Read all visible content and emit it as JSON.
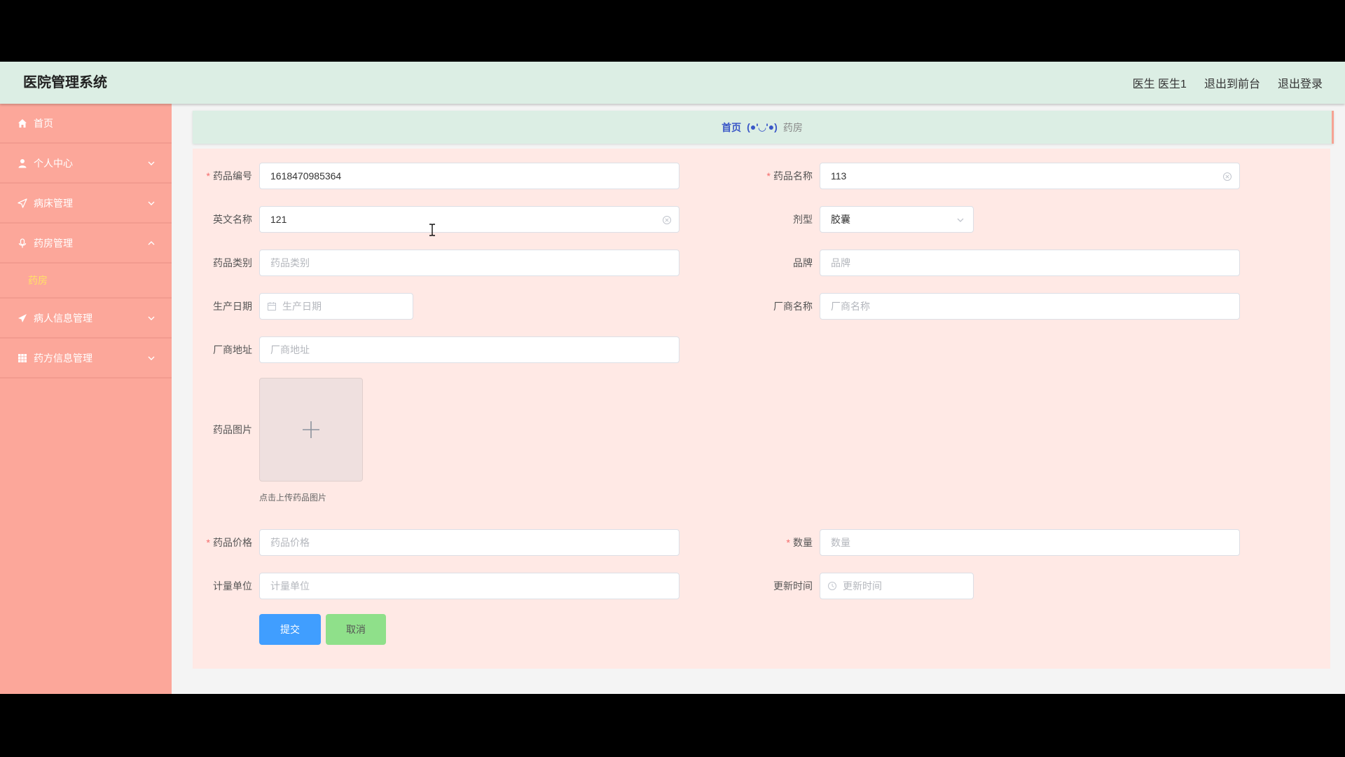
{
  "header": {
    "brand": "医院管理系统",
    "user_label": "医生 医生1",
    "front_label": "退出到前台",
    "logout_label": "退出登录"
  },
  "sidebar": {
    "items": [
      {
        "label": "首页",
        "icon": "home-icon"
      },
      {
        "label": "个人中心",
        "icon": "user-icon"
      },
      {
        "label": "病床管理",
        "icon": "send-icon"
      },
      {
        "label": "药房管理",
        "icon": "microphone-icon",
        "expanded": true
      },
      {
        "label": "病人信息管理",
        "icon": "paper-plane-icon"
      },
      {
        "label": "药方信息管理",
        "icon": "grid-icon"
      }
    ],
    "subitem": "药房"
  },
  "breadcrumb": {
    "home": "首页",
    "separator": "(●'◡'●)",
    "current": "药房"
  },
  "form": {
    "drug_code": {
      "label": "药品编号",
      "value": "1618470985364",
      "required": true
    },
    "drug_name": {
      "label": "药品名称",
      "value": "113",
      "required": true
    },
    "english_name": {
      "label": "英文名称",
      "value": "121"
    },
    "dosage_form": {
      "label": "剂型",
      "value": "胶囊"
    },
    "drug_category": {
      "label": "药品类别",
      "placeholder": "药品类别"
    },
    "brand": {
      "label": "品牌",
      "placeholder": "品牌"
    },
    "production_date": {
      "label": "生产日期",
      "placeholder": "生产日期"
    },
    "manufacturer_name": {
      "label": "厂商名称",
      "placeholder": "厂商名称"
    },
    "manufacturer_address": {
      "label": "厂商地址",
      "placeholder": "厂商地址"
    },
    "drug_image": {
      "label": "药品图片",
      "tip": "点击上传药品图片"
    },
    "drug_price": {
      "label": "药品价格",
      "placeholder": "药品价格",
      "required": true
    },
    "quantity": {
      "label": "数量",
      "placeholder": "数量",
      "required": true
    },
    "unit": {
      "label": "计量单位",
      "placeholder": "计量单位"
    },
    "update_time": {
      "label": "更新时间",
      "placeholder": "更新时间"
    }
  },
  "buttons": {
    "submit": "提交",
    "cancel": "取消"
  },
  "colors": {
    "sidebar": "#fca79a",
    "header": "#dceee4",
    "form_bg": "#ffe9e5",
    "primary": "#409eff",
    "cancel": "#8fe08a",
    "active_submenu": "#ffe066"
  }
}
